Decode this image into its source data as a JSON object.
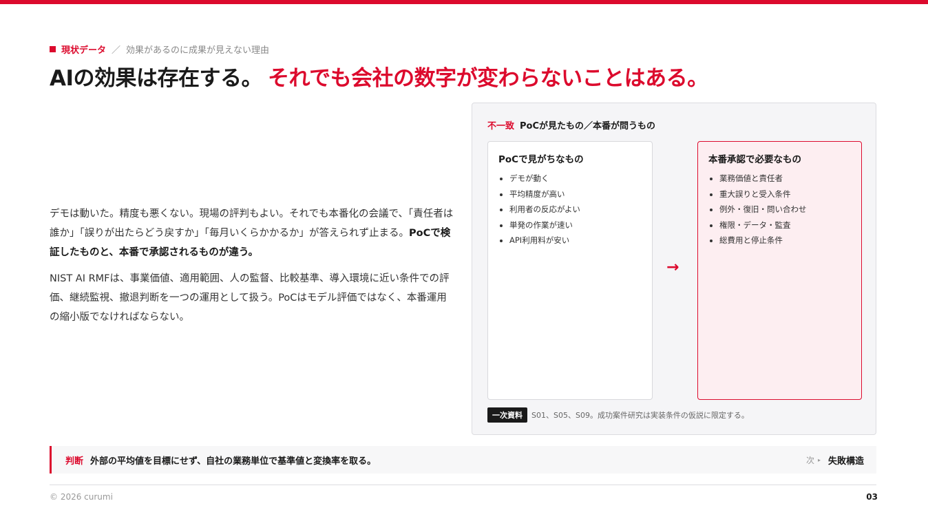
{
  "header": {
    "section": "現状データ",
    "separator": "／",
    "subtitle": "効果があるのに成果が見えない理由",
    "title_main": "AIの効果は存在する。",
    "title_accent": "それでも会社の数字が変わらないことはある。"
  },
  "lead": {
    "p1_text": "デモは動いた。精度も悪くない。現場の評判もよい。それでも本番化の会議で、「責任者は誰か」「誤りが出たらどう戻すか」「毎月いくらかかるか」が答えられず止まる。",
    "p1_bold": "PoCで検証したものと、本番で承認されるものが違う。",
    "p2": "NIST AI RMFは、事業価値、適用範囲、人の監督、比較基準、導入環境に近い条件での評価、継続監視、撤退判断を一つの運用として扱う。PoCはモデル評価ではなく、本番運用の縮小版でなければならない。"
  },
  "panel": {
    "tag": "不一致",
    "title": "PoCが見たもの／本番が問うもの",
    "left": {
      "heading": "PoCで見がちなもの",
      "items": [
        "デモが動く",
        "平均精度が高い",
        "利用者の反応がよい",
        "単発の作業が速い",
        "API利用料が安い"
      ]
    },
    "arrow": "→",
    "right": {
      "heading": "本番承認で必要なもの",
      "items": [
        "業務価値と責任者",
        "重大誤りと受入条件",
        "例外・復旧・問い合わせ",
        "権限・データ・監査",
        "総費用と停止条件"
      ]
    },
    "source_badge": "一次資料",
    "source_text": "S01、S05、S09。成功案件研究は実装条件の仮説に限定する。"
  },
  "judgement": {
    "label": "判断",
    "text": "外部の平均値を目標にせず、自社の業務単位で基準値と変換率を取る。",
    "next_label": "次",
    "next_marker": "▸",
    "next_value": "失敗構造"
  },
  "footer": {
    "copyright": "© 2026 curumi",
    "page": "03"
  },
  "colors": {
    "accent": "#dc0a2d",
    "text": "#1a1a1a",
    "panel_bg": "#f5f5f7",
    "card_accent_bg": "#fdeef1"
  }
}
